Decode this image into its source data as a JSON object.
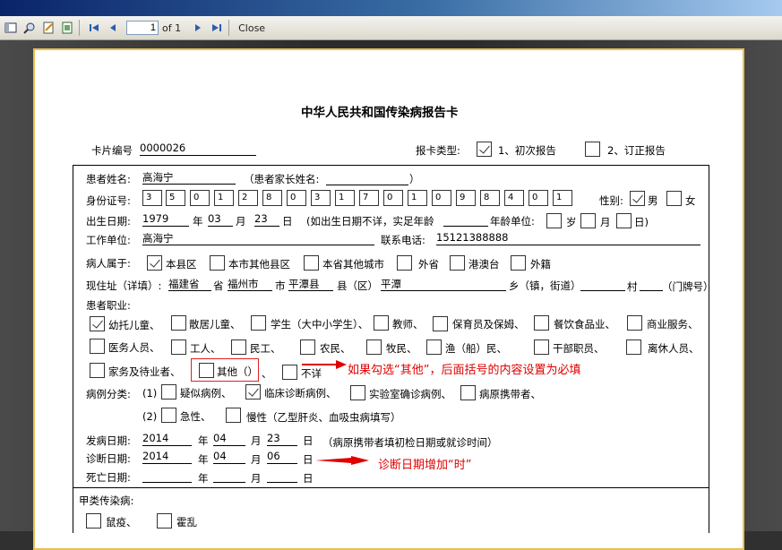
{
  "toolbar": {
    "page": "1",
    "of": "of 1",
    "close": "Close"
  },
  "form": {
    "title": "中华人民共和国传染病报告卡",
    "card_no_label": "卡片编号",
    "card_no": "0000026",
    "report_type_label": "报卡类型:",
    "first_report": "1、初次报告",
    "correction": "2、订正报告",
    "patient_name_label": "患者姓名:",
    "patient_name": "高海宁",
    "guardian_label": "（患者家长姓名:",
    "guardian_close": "）",
    "id_label": "身份证号:",
    "id_digits": [
      "3",
      "5",
      "0",
      "1",
      "2",
      "8",
      "0",
      "3",
      "1",
      "7",
      "0",
      "1",
      "0",
      "9",
      "8",
      "4",
      "0",
      "1"
    ],
    "sex_label": "性别:",
    "male": "男",
    "female": "女",
    "birth_label": "出生日期:",
    "birth_year": "1979",
    "year": "年",
    "birth_month": "03",
    "month": "月",
    "birth_day": "23",
    "day": "日",
    "age_note": "(如出生日期不详，实足年龄",
    "age_unit_label": "年龄单位:",
    "age_year": "岁",
    "age_month": "月",
    "age_day": "日)",
    "work_label": "工作单位:",
    "work": "高海宁",
    "phone_label": "联系电话:",
    "phone": "15121388888",
    "belong_label": "病人属于:",
    "belong": [
      "本县区",
      "本市其他县区",
      "本省其他城市",
      "外省",
      "港澳台",
      "外籍"
    ],
    "addr_label": "现住址（详填）:",
    "province": "福建省",
    "prov_unit": "省",
    "city": "福州市",
    "city_unit": "市",
    "county": "平潭县",
    "county_unit": "县（区）",
    "town": "平潭",
    "town_unit": "乡（镇，街道）",
    "village_unit": "村",
    "house_unit": "（门牌号）",
    "job_label": "患者职业:",
    "jobs": [
      "幼托儿童、",
      "散居儿童、",
      "学生（大中小学生）、",
      "教师、",
      "保育员及保姆、",
      "餐饮食品业、",
      "商业服务、",
      "医务人员、",
      "工人、",
      "民工、",
      "农民、",
      "牧民、",
      "渔（船）民、",
      "干部职员、",
      "离休人员、",
      "家务及待业者、",
      "其他（）",
      "、",
      "不详"
    ],
    "annotation1": "如果勾选“其他”，后面括号的内容设置为必填",
    "case_label": "病例分类:",
    "case1_prefix": "(1)",
    "case1": [
      "疑似病例、",
      "临床诊断病例、",
      "实验室确诊病例、",
      "病原携带者、"
    ],
    "case2_prefix": "(2)",
    "case2": [
      "急性、",
      "慢性（乙型肝炎、血吸虫病填写）"
    ],
    "onset_label": "发病日期:",
    "onset_year": "2014",
    "onset_month": "04",
    "onset_day": "23",
    "onset_note": "（病原携带者填初检日期或就诊时间）",
    "diag_label": "诊断日期:",
    "diag_year": "2014",
    "diag_month": "04",
    "diag_day": "06",
    "annotation2": "诊断日期增加“时”",
    "death_label": "死亡日期:",
    "classA_label": "甲类传染病:",
    "classA": [
      "鼠疫、",
      "霍乱"
    ]
  }
}
